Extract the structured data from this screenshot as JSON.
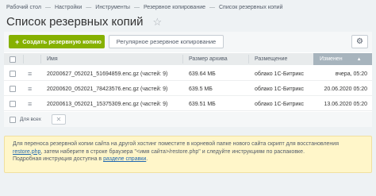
{
  "breadcrumb": [
    "Рабочий стол",
    "Настройки",
    "Инструменты",
    "Резервное копирование",
    "Список резервных копий"
  ],
  "page": {
    "title": "Список резервных копий",
    "star_icon": "☆"
  },
  "toolbar": {
    "create_label": "Создать резервную копию",
    "regular_label": "Регулярное резервное копирование",
    "settings_icon": "⚙"
  },
  "table": {
    "headers": {
      "name": "Имя",
      "size": "Размер архива",
      "location": "Размещение",
      "modified": "Изменен"
    },
    "sort_arrow": "▲",
    "rows": [
      {
        "name": "20200627_052021_51694859.enc.gz (частей: 9)",
        "size": "639.64 МБ",
        "location": "облако 1С-Битрикс",
        "modified": "вчера, 05:20"
      },
      {
        "name": "20200620_052021_78423576.enc.gz (частей: 9)",
        "size": "639.5 МБ",
        "location": "облако 1С-Битрикс",
        "modified": "20.06.2020 05:20"
      },
      {
        "name": "20200613_052021_15375309.enc.gz (частей: 9)",
        "size": "639.51 МБ",
        "location": "облако 1С-Битрикс",
        "modified": "13.06.2020 05:20"
      }
    ],
    "menu_icon": "≡",
    "footer": {
      "for_all_label": "Для всех",
      "close_icon": "✕"
    }
  },
  "info": {
    "line1": "Для переноса резервной копии сайта на другой хостинг поместите в корневой папке нового сайта скрипт для восстановления",
    "line2_link": "restore.php",
    "line2_rest": ", затем наберите в строке браузера \"<имя сайта>/restore.php\" и следуйте инструкциям по распаковке.",
    "line3_prefix": "Подробная инструкция доступна в ",
    "line3_link": "разделе справки",
    "line3_suffix": "."
  }
}
